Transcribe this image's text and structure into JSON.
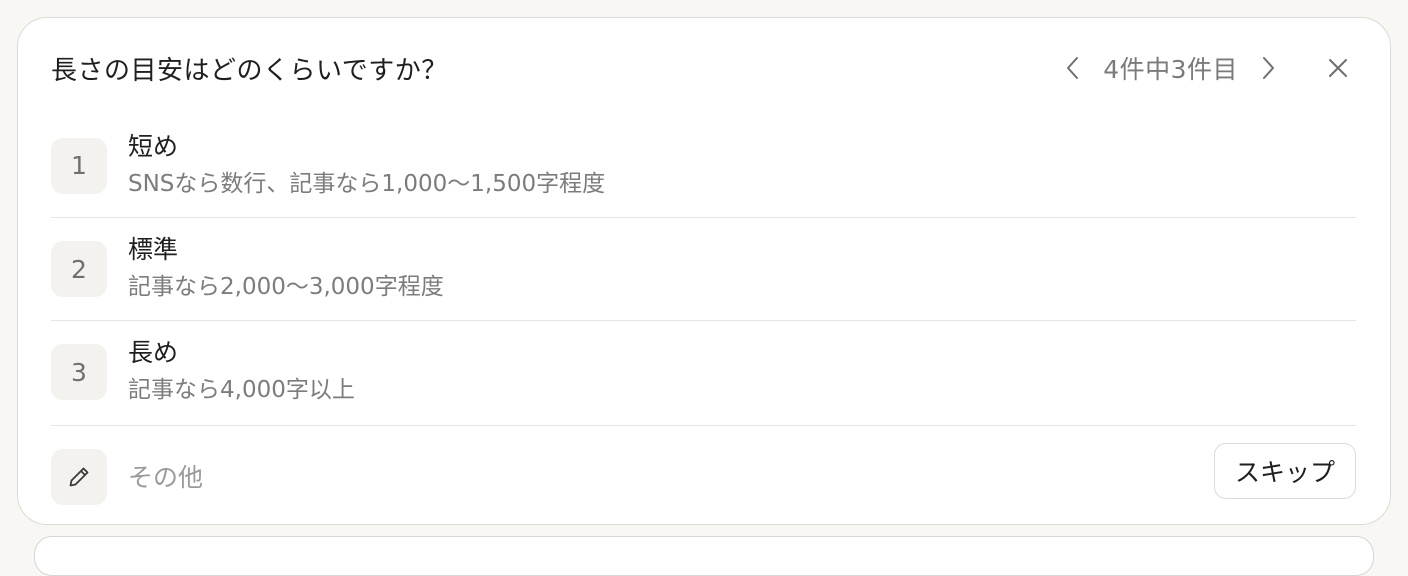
{
  "question": {
    "title": "長さの目安はどのくらいですか？",
    "counter": "4件中3件目"
  },
  "options": [
    {
      "number": "1",
      "label": "短め",
      "description": "SNSなら数行、記事なら1,000〜1,500字程度"
    },
    {
      "number": "2",
      "label": "標準",
      "description": "記事なら2,000〜3,000字程度"
    },
    {
      "number": "3",
      "label": "長め",
      "description": "記事なら4,000字以上"
    }
  ],
  "other": {
    "placeholder": "その他"
  },
  "actions": {
    "skip_label": "スキップ"
  },
  "icons": {
    "prev": "chevron-left-icon",
    "next": "chevron-right-icon",
    "close": "close-icon",
    "other": "pencil-icon"
  }
}
